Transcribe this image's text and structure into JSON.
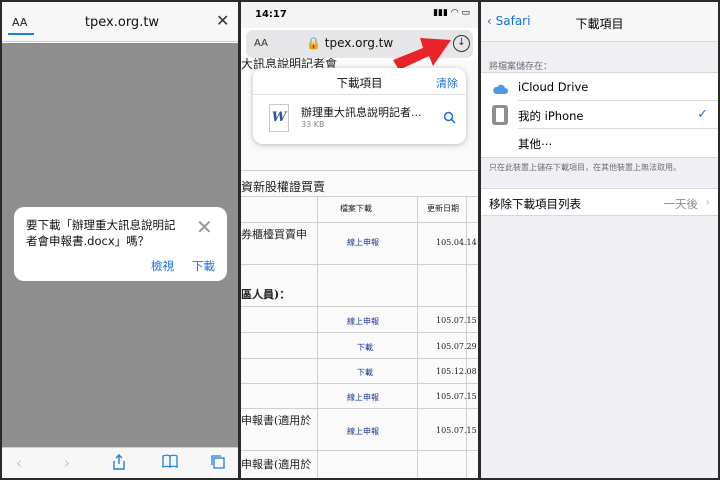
{
  "panel1": {
    "aa_label": "AA",
    "url": "tpex.org.tw",
    "dialog": {
      "message": "要下載「辦理重大訊息說明記者會申報書.docx」嗎？",
      "view_label": "檢視",
      "download_label": "下載"
    },
    "toolbar_icons": [
      "back-icon",
      "forward-icon",
      "share-icon",
      "bookmarks-icon",
      "tabs-icon"
    ]
  },
  "panel2": {
    "status_time": "14:17",
    "aa_label": "AA",
    "url": "tpex.org.tw",
    "popover": {
      "title": "下載項目",
      "clear_label": "清除",
      "file_name": "辦理重大訊息說明記者...",
      "file_size": "33 KB",
      "file_icon_letter": "W"
    },
    "page": {
      "heading1": "大訊息說明記者會",
      "heading2": "資新股權證買賣",
      "col_download": "檔案下載",
      "col_date": "更新日期",
      "row1_text": "券櫃檯買賣申",
      "heading3": "區人員)：",
      "row_text_a": "申報書(適用於",
      "row_text_b": "申報書(適用於",
      "links": [
        "線上申報",
        "線上申報",
        "下載",
        "下載",
        "線上申報",
        "線上申報"
      ],
      "dates": [
        "105.04.14",
        "105.07.15",
        "105.07.29",
        "105.12.08",
        "105.07.15",
        "105.07.15"
      ]
    },
    "accent_color": "#e8242a"
  },
  "panel3": {
    "back_label": "Safari",
    "title": "下載項目",
    "section_label": "將檔案儲存在：",
    "options": [
      {
        "label": "iCloud Drive",
        "icon": "cloud-icon",
        "selected": false
      },
      {
        "label": "我的 iPhone",
        "icon": "iphone-icon",
        "selected": true
      },
      {
        "label": "其他⋯",
        "icon": "",
        "selected": false
      }
    ],
    "footnote": "只在此裝置上儲存下載項目，在其他裝置上無法取用。",
    "remove_label": "移除下載項目列表",
    "remove_value": "一天後"
  }
}
